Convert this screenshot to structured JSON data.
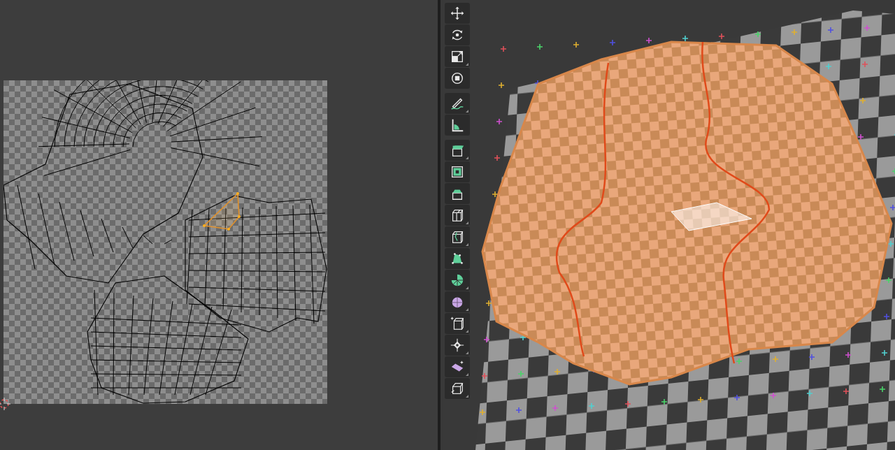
{
  "viewport_toolbar": {
    "groups": [
      {
        "tools": [
          {
            "kind": "move",
            "submenu": false
          },
          {
            "kind": "rotate",
            "submenu": false
          },
          {
            "kind": "scale",
            "submenu": true
          },
          {
            "kind": "transform",
            "submenu": false
          }
        ]
      },
      {
        "tools": [
          {
            "kind": "annotate",
            "submenu": true
          },
          {
            "kind": "measure",
            "submenu": false
          }
        ]
      },
      {
        "tools": [
          {
            "kind": "extrude",
            "submenu": true
          },
          {
            "kind": "inset",
            "submenu": false
          },
          {
            "kind": "bevel",
            "submenu": false
          },
          {
            "kind": "loopcut",
            "submenu": true
          },
          {
            "kind": "knife",
            "submenu": true
          },
          {
            "kind": "polybuild",
            "submenu": false
          },
          {
            "kind": "spin",
            "submenu": true
          },
          {
            "kind": "smooth",
            "submenu": true
          },
          {
            "kind": "edgeslide",
            "submenu": true
          },
          {
            "kind": "shrink",
            "submenu": true
          },
          {
            "kind": "shear",
            "submenu": true
          },
          {
            "kind": "rip",
            "submenu": true
          }
        ]
      }
    ]
  }
}
